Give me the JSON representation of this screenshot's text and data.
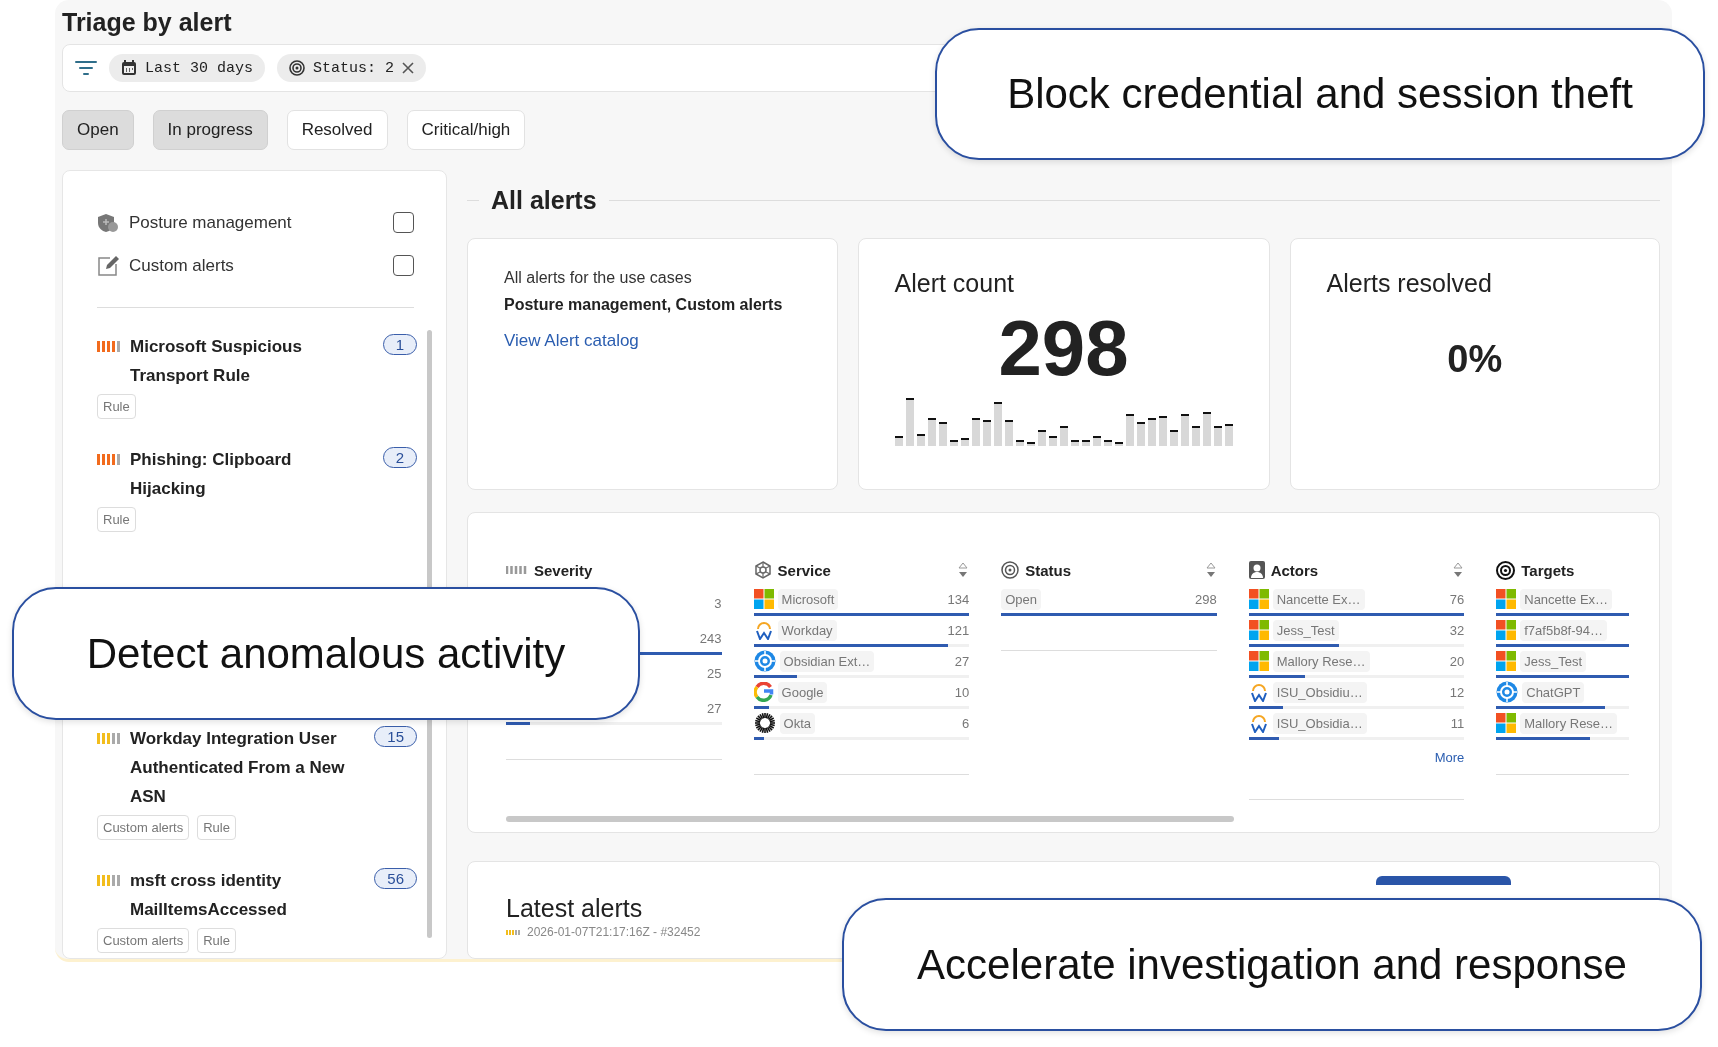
{
  "page": {
    "title": "Triage by alert"
  },
  "filter_bar": {
    "chips": [
      {
        "kind": "date",
        "label": "Last 30 days",
        "removable": false
      },
      {
        "kind": "status",
        "label": "Status: 2",
        "removable": true
      }
    ]
  },
  "status_tabs": [
    {
      "label": "Open",
      "selected": true
    },
    {
      "label": "In progress",
      "selected": true
    },
    {
      "label": "Resolved",
      "selected": false
    },
    {
      "label": "Critical/high",
      "selected": false
    }
  ],
  "use_cases": [
    {
      "kind": "shield",
      "label": "Posture management",
      "checked": false
    },
    {
      "kind": "pencil",
      "label": "Custom alerts",
      "checked": false
    }
  ],
  "alerts": [
    {
      "title": "Microsoft Suspicious Transport Rule",
      "level": 0.8,
      "count": "1",
      "tags": [
        "Rule"
      ]
    },
    {
      "title": "Phishing: Clipboard Hijacking",
      "level": 0.8,
      "count": "2",
      "tags": [
        "Rule"
      ]
    },
    {
      "title": "Workday Integration User Authenticated From a New ASN",
      "level": 0.6,
      "count": "15",
      "tags": [
        "Custom alerts",
        "Rule"
      ]
    },
    {
      "title": "msft cross identity MailItemsAccessed",
      "level": 0.6,
      "count": "56",
      "tags": [
        "Custom alerts",
        "Rule"
      ]
    }
  ],
  "section_title": "All alerts",
  "summary": {
    "intro": "All alerts for the use cases",
    "use_cases": "Posture management, Custom alerts",
    "link": "View Alert catalog"
  },
  "alert_count": {
    "title": "Alert count",
    "value": "298"
  },
  "alerts_resolved": {
    "title": "Alerts resolved",
    "value": "0%"
  },
  "breakdown": {
    "columns": [
      {
        "kind": "severity",
        "title": "Severity",
        "sortable": false,
        "rows": [
          {
            "count": "3"
          },
          {
            "count": "243",
            "level": 1
          },
          {
            "count": "25"
          },
          {
            "count": "27",
            "level": 0.11
          }
        ]
      },
      {
        "kind": "service",
        "title": "Service",
        "sortable": true,
        "rows": [
          {
            "kind": "grid",
            "label": "Microsoft",
            "count": "134",
            "level": 1
          },
          {
            "kind": "arc",
            "label": "Workday",
            "count": "121",
            "level": 0.9
          },
          {
            "kind": "crosshair",
            "label": "Obsidian Ext…",
            "count": "27",
            "level": 0.2
          },
          {
            "kind": "ring",
            "label": "Google",
            "count": "10",
            "level": 0.07
          },
          {
            "kind": "sunburst",
            "label": "Okta",
            "count": "6",
            "level": 0.05
          }
        ]
      },
      {
        "kind": "status",
        "title": "Status",
        "sortable": true,
        "rows": [
          {
            "label": "Open",
            "count": "298",
            "level": 1
          }
        ]
      },
      {
        "kind": "actors",
        "title": "Actors",
        "sortable": true,
        "more": "More",
        "rows": [
          {
            "kind": "grid",
            "label": "Nancette Ex…",
            "count": "76",
            "level": 1
          },
          {
            "kind": "grid",
            "label": "Jess_Test",
            "count": "32",
            "level": 0.42
          },
          {
            "kind": "grid",
            "label": "Mallory Rese…",
            "count": "20",
            "level": 0.26
          },
          {
            "kind": "arc",
            "label": "ISU_Obsidiu…",
            "count": "12",
            "level": 0.16
          },
          {
            "kind": "arc",
            "label": "ISU_Obsidia…",
            "count": "11",
            "level": 0.14
          }
        ]
      },
      {
        "kind": "targets",
        "title": "Targets",
        "sortable": false,
        "rows": [
          {
            "kind": "grid",
            "label": "Nancette Ex…",
            "level": 1
          },
          {
            "kind": "grid",
            "label": "f7af5b8f-94…",
            "level": 1
          },
          {
            "kind": "grid",
            "label": "Jess_Test",
            "level": 1
          },
          {
            "kind": "crosshair",
            "label": "ChatGPT",
            "level": 0.82
          },
          {
            "kind": "grid",
            "label": "Mallory Rese…",
            "level": 0.71
          }
        ]
      }
    ]
  },
  "latest_alerts": {
    "title": "Latest alerts",
    "rows": [
      {
        "level": 0.6,
        "text": "2026-01-07T21:17:16Z - #32452"
      }
    ]
  },
  "callouts": [
    {
      "text": "Block credential and session theft"
    },
    {
      "text": "Detect anomalous activity"
    },
    {
      "text": "Accelerate investigation and response"
    }
  ]
}
